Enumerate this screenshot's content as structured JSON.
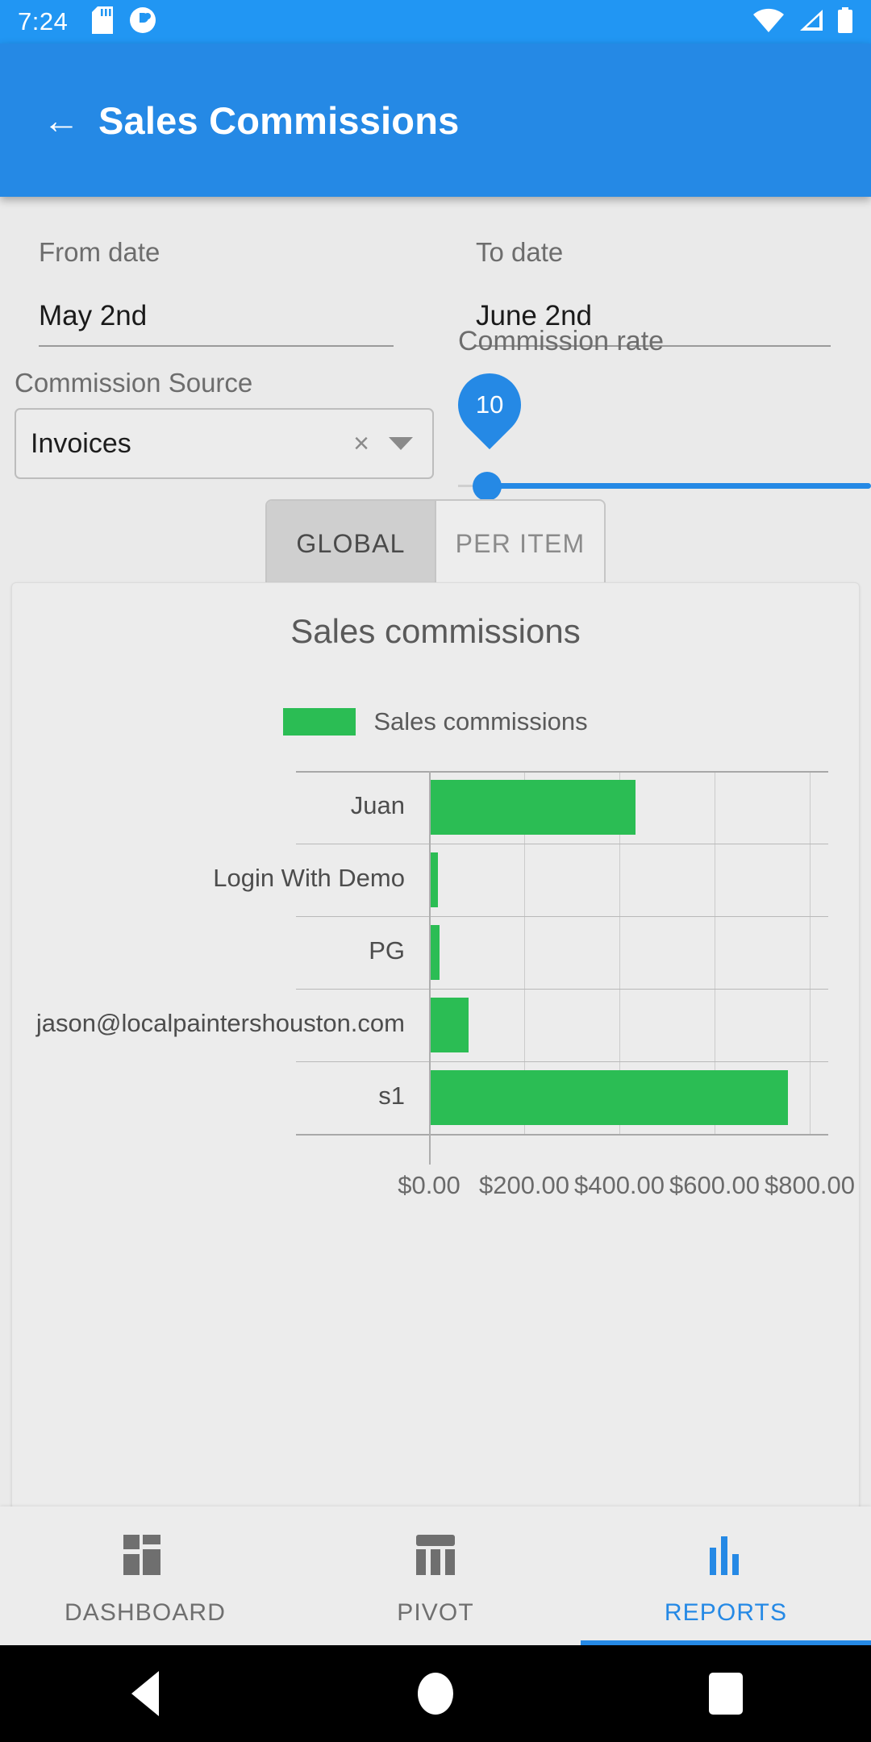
{
  "status_bar": {
    "time": "7:24",
    "icons_left": [
      "sd-card-icon",
      "app-notification-icon"
    ],
    "icons_right": [
      "wifi-icon",
      "cellular-signal-icon",
      "battery-icon"
    ]
  },
  "app_bar": {
    "back_label": "←",
    "title": "Sales Commissions",
    "background": "#2589e5"
  },
  "filters": {
    "from_date": {
      "label": "From date",
      "value": "May 2nd"
    },
    "to_date": {
      "label": "To date",
      "value": "June 2nd"
    },
    "commission_source": {
      "label": "Commission Source",
      "value": "Invoices",
      "clear_glyph": "×",
      "caret": "chevron-down-icon"
    },
    "commission_rate": {
      "label": "Commission rate",
      "value": "10",
      "min": 0,
      "max": 100
    }
  },
  "mode_toggle": {
    "options": [
      "GLOBAL",
      "PER ITEM"
    ],
    "selected": "GLOBAL"
  },
  "chart_data": {
    "type": "bar",
    "orientation": "horizontal",
    "title": "Sales commissions",
    "legend": [
      "Sales commissions"
    ],
    "legend_position": "top-center",
    "series_color": "#2bbd54",
    "categories": [
      "Juan",
      "Login With Demo",
      "PG",
      "jason@localpaintershouston.com",
      "s1"
    ],
    "values": [
      430,
      15,
      18,
      80,
      750
    ],
    "xlabel": "",
    "ylabel": "",
    "xlim": [
      0,
      900
    ],
    "xticks": [
      "$0.00",
      "$200.00",
      "$400.00",
      "$600.00",
      "$800.00"
    ],
    "xtick_values": [
      0,
      200,
      400,
      600,
      800
    ],
    "grid": true
  },
  "bottom_nav": {
    "items": [
      {
        "label": "DASHBOARD",
        "icon": "dashboard-grid-icon",
        "active": false
      },
      {
        "label": "PIVOT",
        "icon": "pivot-table-icon",
        "active": false
      },
      {
        "label": "REPORTS",
        "icon": "bar-chart-icon",
        "active": true
      }
    ],
    "accent": "#2589e5"
  },
  "android_nav": {
    "back": "back-triangle-icon",
    "home": "home-circle-icon",
    "recents": "recents-square-icon"
  }
}
